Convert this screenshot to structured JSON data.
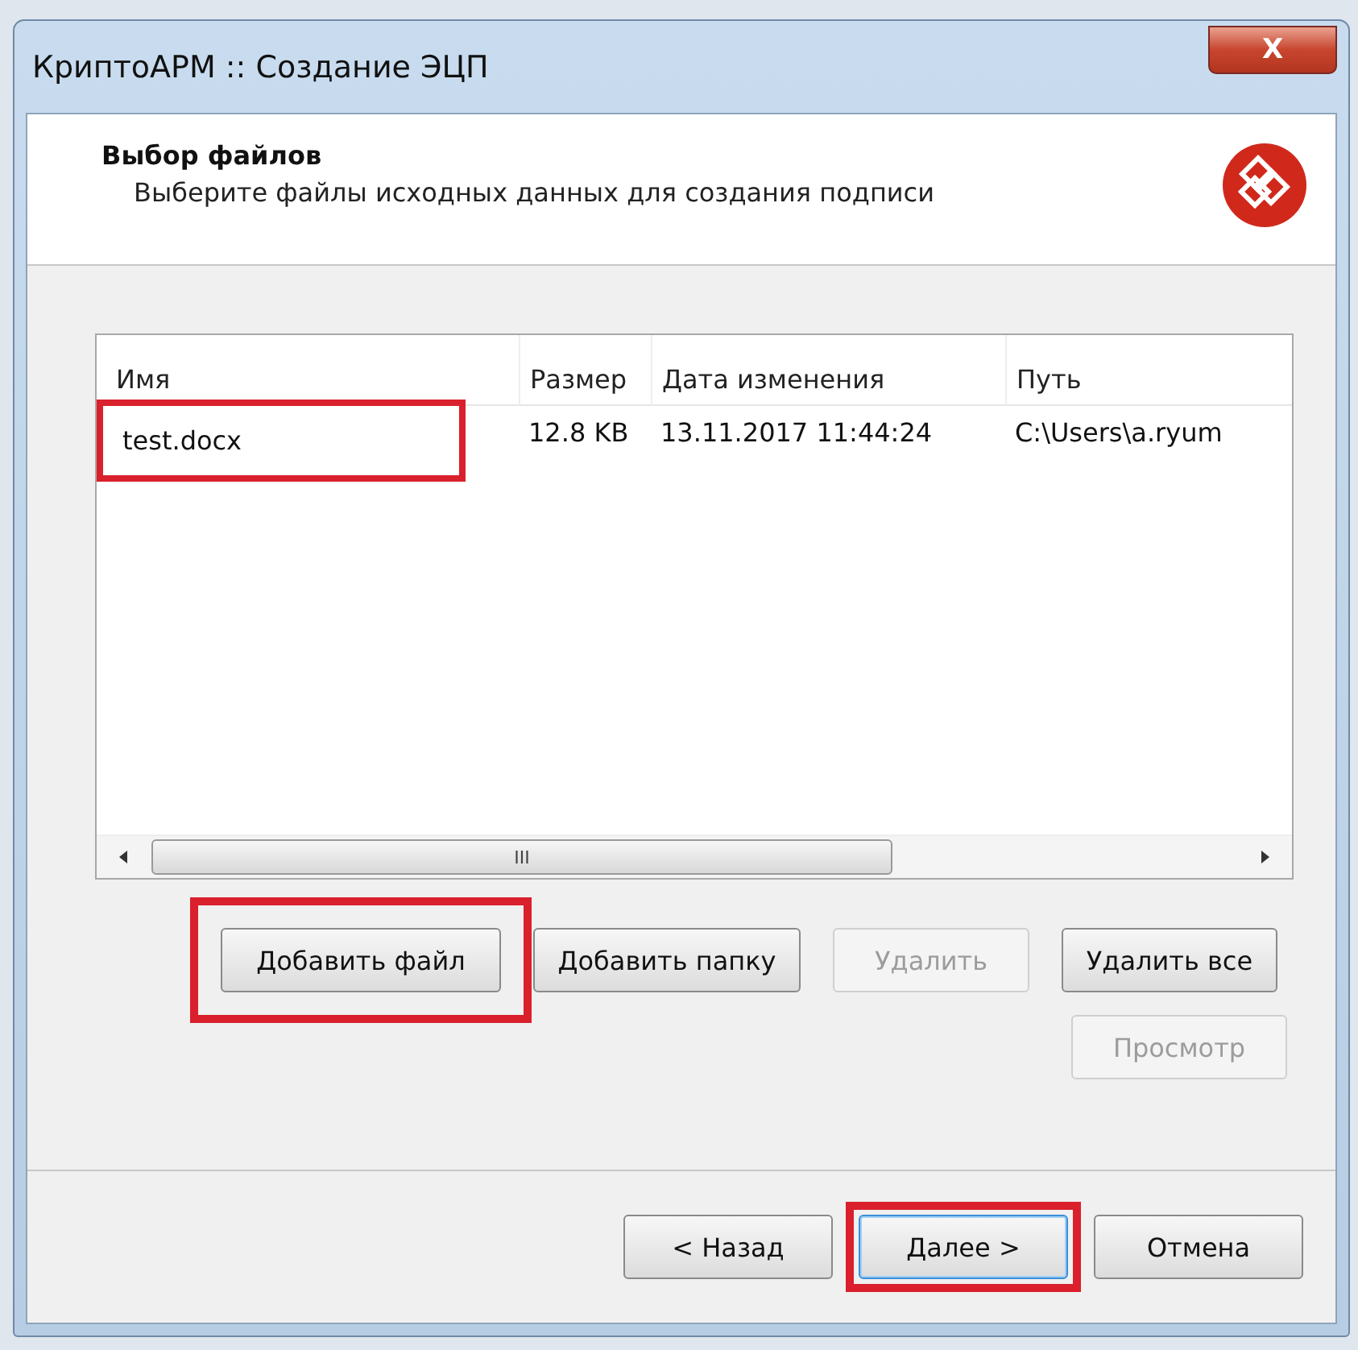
{
  "window": {
    "title": "КриптоАРМ :: Создание ЭЦП",
    "close": "X"
  },
  "header": {
    "title": "Выбор файлов",
    "subtitle": "Выберите файлы исходных данных для создания подписи"
  },
  "table": {
    "columns": [
      "Имя",
      "Размер",
      "Дата изменения",
      "Путь"
    ],
    "rows": [
      {
        "cells": [
          "test.docx",
          "12.8 KB",
          "13.11.2017 11:44:24",
          "C:\\Users\\a.ryum"
        ],
        "highlighted": true
      }
    ]
  },
  "scrollbar": {
    "grip": "III"
  },
  "file_buttons": [
    {
      "label": "Добавить файл",
      "disabled": false,
      "highlighted": true
    },
    {
      "label": "Добавить папку",
      "disabled": false,
      "highlighted": false
    },
    {
      "label": "Удалить",
      "disabled": true,
      "highlighted": false
    },
    {
      "label": "Удалить все",
      "disabled": false,
      "highlighted": false
    }
  ],
  "view_button": {
    "label": "Просмотр",
    "disabled": true
  },
  "nav_buttons": [
    {
      "label": "< Назад",
      "highlighted": false,
      "focused": false
    },
    {
      "label": "Далее >",
      "highlighted": true,
      "focused": true
    },
    {
      "label": "Отмена",
      "highlighted": false,
      "focused": false
    }
  ]
}
